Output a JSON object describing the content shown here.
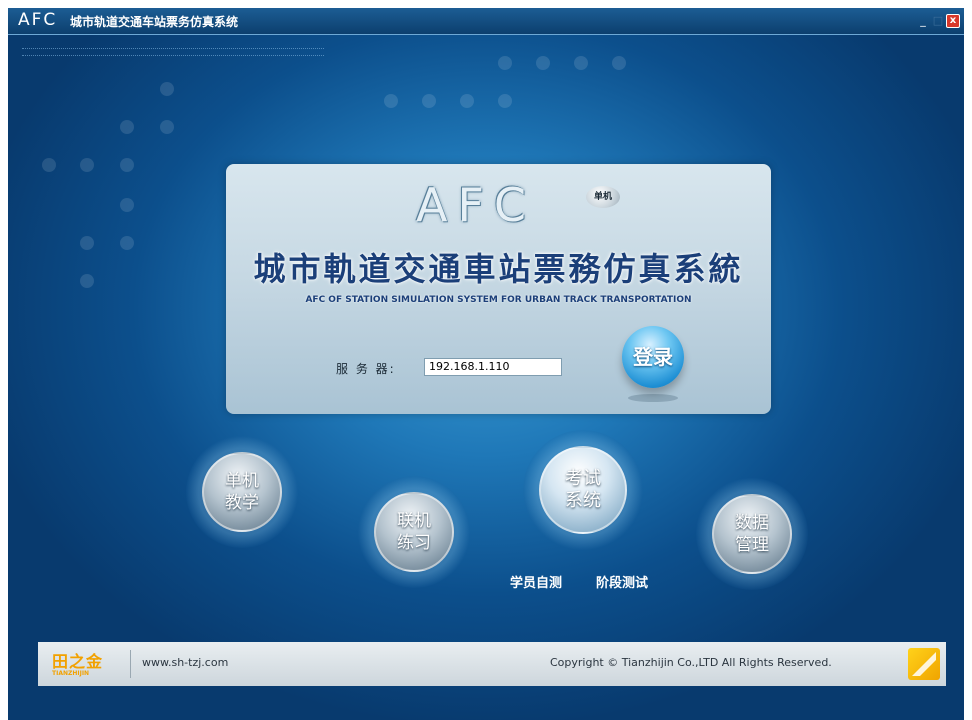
{
  "window": {
    "logo": "AFC",
    "title": "城市轨道交通车站票务仿真系统",
    "min_label": "_",
    "max_label": "□",
    "close_label": "x"
  },
  "login": {
    "afc_logo": "AFC",
    "badge": "单机",
    "title_cn": "城市軌道交通車站票務仿真系統",
    "title_en": "AFC OF STATION SIMULATION SYSTEM FOR URBAN TRACK TRANSPORTATION",
    "server_label": "服 务 器:",
    "server_value": "192.168.1.110",
    "button_label": "登录"
  },
  "modules": {
    "standalone": "单机\n教学",
    "network": "联机\n练习",
    "exam": "考试\n系统",
    "data": "数据\n管理"
  },
  "exam_links": {
    "self_test": "学员自测",
    "stage_test": "阶段测试"
  },
  "footer": {
    "logo_cn": "田之金",
    "logo_en": "TIANZHIJIN",
    "url": "www.sh-tzj.com",
    "copyright": "Copyright © Tianzhijin Co.,LTD All Rights Reserved."
  }
}
